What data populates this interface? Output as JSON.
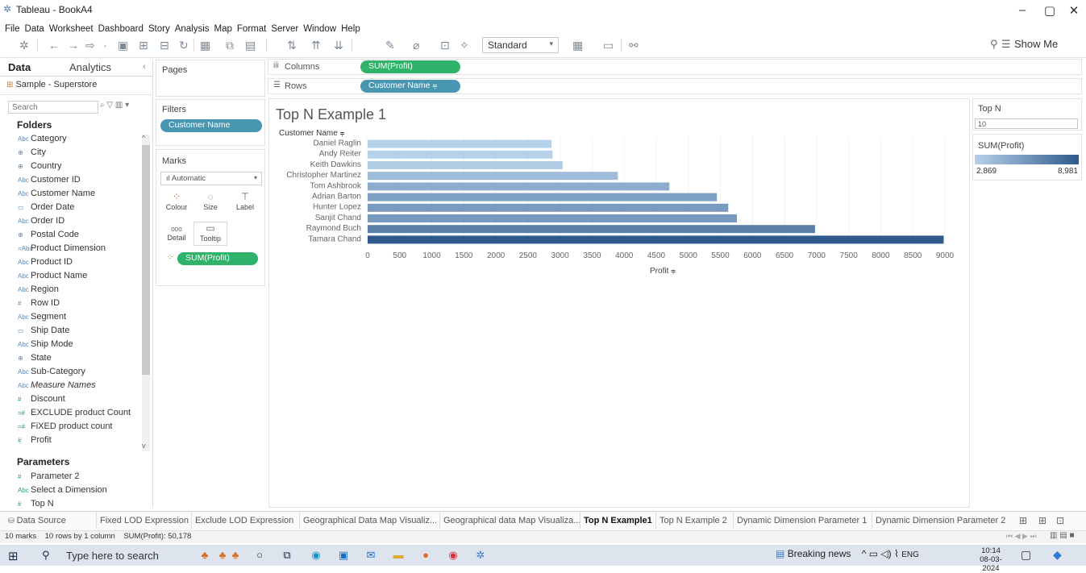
{
  "window": {
    "title": "Tableau - BookA4",
    "minimize": "–",
    "restore": "▢",
    "close": "✕"
  },
  "menu": [
    "File",
    "Data",
    "Worksheet",
    "Dashboard",
    "Story",
    "Analysis",
    "Map",
    "Format",
    "Server",
    "Window",
    "Help"
  ],
  "toolbar": {
    "fit_select": "Standard",
    "show_me": "Show Me",
    "icons": [
      "tableau-logo-icon",
      "undo-icon",
      "redo-icon",
      "forward-icon",
      "save-icon",
      "new-datasource-icon",
      "pause-icon",
      "refresh-icon",
      "new-sheet-icon",
      "duplicate-icon",
      "clear-sheet-icon",
      "swap-icon",
      "sort-asc-icon",
      "sort-desc-icon",
      "highlight-icon",
      "group-icon",
      "label-icon",
      "fix-axes-icon",
      "fit-icon",
      "presentation-icon",
      "share-icon"
    ]
  },
  "data_pane": {
    "tab_data": "Data",
    "tab_analytics": "Analytics",
    "collapse": "‹",
    "datasource": "Sample - Superstore",
    "search_placeholder": "Search",
    "search_icons": "⌕ ▽ ▥ ▾",
    "folders_title": "Folders",
    "fields": [
      {
        "icon": "Abc",
        "name": "Category",
        "type": "dim"
      },
      {
        "icon": "⊕",
        "name": "City",
        "type": "dim"
      },
      {
        "icon": "⊕",
        "name": "Country",
        "type": "dim"
      },
      {
        "icon": "Abc",
        "name": "Customer ID",
        "type": "dim"
      },
      {
        "icon": "Abc",
        "name": "Customer Name",
        "type": "dim"
      },
      {
        "icon": "▭",
        "name": "Order Date",
        "type": "dim"
      },
      {
        "icon": "Abc",
        "name": "Order ID",
        "type": "dim"
      },
      {
        "icon": "⊕",
        "name": "Postal Code",
        "type": "dim"
      },
      {
        "icon": "=Abc",
        "name": "Product Dimension",
        "type": "dim"
      },
      {
        "icon": "Abc",
        "name": "Product ID",
        "type": "dim"
      },
      {
        "icon": "Abc",
        "name": "Product Name",
        "type": "dim"
      },
      {
        "icon": "Abc",
        "name": "Region",
        "type": "dim"
      },
      {
        "icon": "#",
        "name": "Row ID",
        "type": "dim"
      },
      {
        "icon": "Abc",
        "name": "Segment",
        "type": "dim"
      },
      {
        "icon": "▭",
        "name": "Ship Date",
        "type": "dim"
      },
      {
        "icon": "Abc",
        "name": "Ship Mode",
        "type": "dim"
      },
      {
        "icon": "⊕",
        "name": "State",
        "type": "dim"
      },
      {
        "icon": "Abc",
        "name": "Sub-Category",
        "type": "dim"
      },
      {
        "icon": "Abc",
        "name": "Measure Names",
        "type": "dim",
        "italic": true
      },
      {
        "icon": "#",
        "name": "Discount",
        "type": "meas"
      },
      {
        "icon": "=#",
        "name": "EXCLUDE product Count",
        "type": "meas"
      },
      {
        "icon": "=#",
        "name": "FiXED product count",
        "type": "meas"
      },
      {
        "icon": "#",
        "name": "Profit",
        "type": "meas"
      }
    ],
    "params_title": "Parameters",
    "params": [
      {
        "icon": "#",
        "name": "Parameter 2"
      },
      {
        "icon": "Abc",
        "name": "Select a Dimension"
      },
      {
        "icon": "#",
        "name": "Top N"
      }
    ]
  },
  "cards": {
    "pages": "Pages",
    "filters": "Filters",
    "filter_pill": "Customer Name",
    "marks": "Marks",
    "marks_type": "Automatic",
    "marks_type_icon": "bar-chart-icon",
    "mark_buttons": [
      {
        "label": "Colour",
        "icon": "colour-icon"
      },
      {
        "label": "Size",
        "icon": "size-icon"
      },
      {
        "label": "Label",
        "icon": "label-icon"
      },
      {
        "label": "Detail",
        "icon": "detail-icon"
      },
      {
        "label": "Tooltip",
        "icon": "tooltip-icon"
      }
    ],
    "marks_pill": "SUM(Profit)"
  },
  "shelves": {
    "columns_label": "Columns",
    "columns_pill": "SUM(Profit)",
    "rows_label": "Rows",
    "rows_pill": "Customer Name"
  },
  "view": {
    "title": "Top N Example 1"
  },
  "right_cards": {
    "topn_title": "Top N",
    "topn_value": "10",
    "legend_title": "SUM(Profit)",
    "legend_min": "2,869",
    "legend_max": "8,981",
    "legend_colors": [
      "#b6d1ea",
      "#2f5a8c"
    ]
  },
  "sheet_tabs": {
    "datasource": "Data Source",
    "tabs": [
      "Fixed LOD Expression",
      "Exclude LOD Expression",
      "Geographical Data Map Visualiz...",
      "Geographical data Map Visualiza...",
      "Top N Example1",
      "Top N Example 2",
      "Dynamic Dimension Parameter 1",
      "Dynamic Dimension Parameter 2"
    ],
    "active": "Top N Example1"
  },
  "status_bar": {
    "marks": "10 marks",
    "rows": "10 rows by 1 column",
    "sum": "SUM(Profit): 50,178"
  },
  "taskbar": {
    "search_placeholder": "Type here to search",
    "news": "Breaking news",
    "lang": "ENG",
    "time": "10:14",
    "date": "08-03-2024"
  },
  "chart_data": {
    "type": "bar",
    "orientation": "horizontal",
    "title": "Top N Example 1",
    "ylabel": "Customer Name",
    "xlabel": "Profit",
    "categories": [
      "Daniel Raglin",
      "Andy Reiter",
      "Keith Dawkins",
      "Christopher Martinez",
      "Tom Ashbrook",
      "Adrian Barton",
      "Hunter Lopez",
      "Sanjit Chand",
      "Raymond Buch",
      "Tamara Chand"
    ],
    "values": [
      2869,
      2884,
      3039,
      3900,
      4704,
      5445,
      5622,
      5757,
      6976,
      8981
    ],
    "xlim": [
      0,
      9000
    ],
    "xticks": [
      0,
      500,
      1000,
      1500,
      2000,
      2500,
      3000,
      3500,
      4000,
      4500,
      5000,
      5500,
      6000,
      6500,
      7000,
      7500,
      8000,
      8500,
      9000
    ],
    "color_scale": [
      "#b6d1ea",
      "#2f5a8c"
    ]
  }
}
